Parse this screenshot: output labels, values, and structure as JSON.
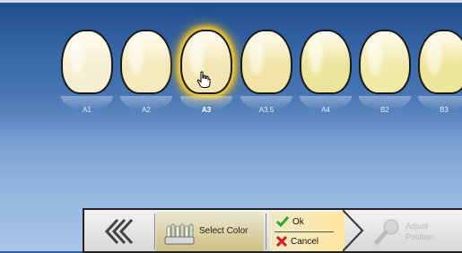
{
  "shades": [
    {
      "label": "A1",
      "color": "#f6efd1",
      "selected": false
    },
    {
      "label": "A2",
      "color": "#f4eabd",
      "selected": false
    },
    {
      "label": "A3",
      "color": "#f3e6b4",
      "selected": true
    },
    {
      "label": "A3.5",
      "color": "#f1e4a6",
      "selected": false
    },
    {
      "label": "A4",
      "color": "#ede39a",
      "selected": false
    },
    {
      "label": "B2",
      "color": "#f1e9a8",
      "selected": false
    },
    {
      "label": "B3",
      "color": "#eee59a",
      "selected": false
    }
  ],
  "toolbar": {
    "back_icon": "double-chevron-left-icon",
    "select_color_label": "Select Color",
    "select_color_icon": "shade-guide-icon",
    "ok_label": "Ok",
    "cancel_label": "Cancel",
    "next_label_line1": "Adjust",
    "next_label_line2": "Position",
    "next_icon": "wrench-icon"
  },
  "colors": {
    "selection_glow": "#ffd22a",
    "ok_check": "#2ea82e",
    "cancel_x": "#d02020"
  }
}
